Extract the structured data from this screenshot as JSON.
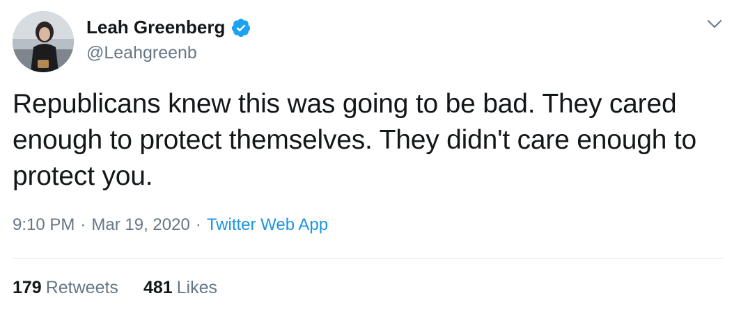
{
  "author": {
    "display_name": "Leah Greenberg",
    "handle": "@Leahgreenb",
    "verified": true,
    "verified_color": "#1da1f2"
  },
  "tweet": {
    "text": "Republicans knew this was going to be bad. They cared enough to protect themselves. They didn't care enough to protect you."
  },
  "meta": {
    "time": "9:10 PM",
    "separator": "·",
    "date": "Mar 19, 2020",
    "source": "Twitter Web App"
  },
  "stats": {
    "retweets_count": "179",
    "retweets_label": "Retweets",
    "likes_count": "481",
    "likes_label": "Likes"
  },
  "icons": {
    "verified": "verified-badge-icon",
    "menu": "chevron-down-icon"
  },
  "colors": {
    "link": "#1b95e0",
    "secondary_text": "#657786",
    "primary_text": "#14171a"
  }
}
